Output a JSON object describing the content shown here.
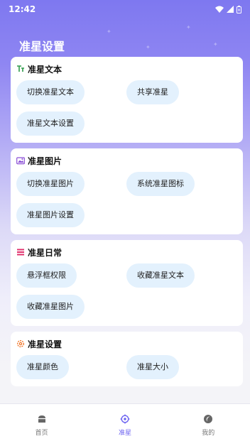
{
  "status_bar": {
    "time": "12:42"
  },
  "page_title": "准星设置",
  "colors": {
    "accent": "#6c63f0",
    "chip_bg": "#e3f1fd",
    "icon_text": "#2e9b4a",
    "icon_image": "#8a4fd6",
    "icon_daily": "#e0326e",
    "icon_settings": "#f07020"
  },
  "sections": [
    {
      "title": "准星文本",
      "icon": "text-format-icon",
      "buttons": [
        "切换准星文本",
        "共享准星",
        "准星文本设置"
      ]
    },
    {
      "title": "准星图片",
      "icon": "image-icon",
      "buttons": [
        "切换准星图片",
        "系统准星图标",
        "准星图片设置"
      ]
    },
    {
      "title": "准星日常",
      "icon": "list-icon",
      "buttons": [
        "悬浮框权限",
        "收藏准星文本",
        "收藏准星图片"
      ]
    },
    {
      "title": "准星设置",
      "icon": "gear-icon",
      "buttons": [
        "准星颜色",
        "准星大小"
      ]
    }
  ],
  "bottom_nav": {
    "items": [
      {
        "label": "首页",
        "icon": "home-icon"
      },
      {
        "label": "准星",
        "icon": "crosshair-icon",
        "active": true
      },
      {
        "label": "我的",
        "icon": "profile-icon"
      }
    ]
  }
}
